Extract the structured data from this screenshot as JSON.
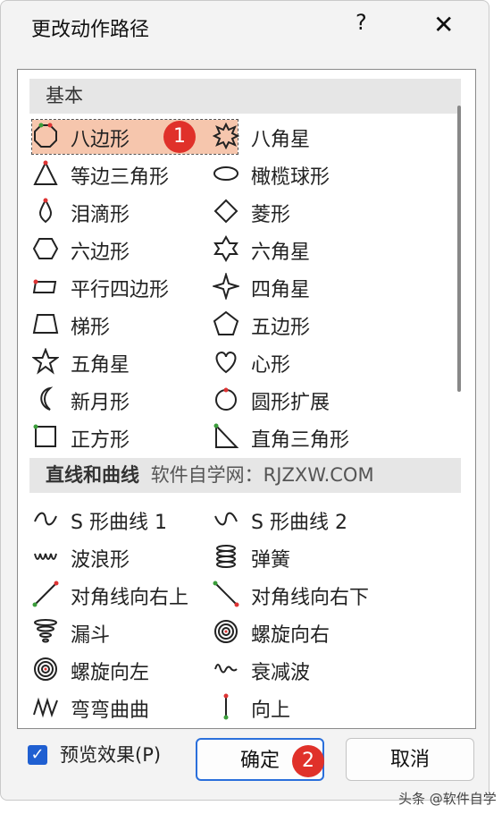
{
  "dialog": {
    "title": "更改动作路径",
    "help": "?",
    "close": "✕"
  },
  "groups": [
    {
      "title": "基本",
      "extra": ""
    },
    {
      "title": "直线和曲线",
      "extra": "软件自学网：RJZXW.COM"
    }
  ],
  "basic_items": [
    [
      "八边形",
      "八角星"
    ],
    [
      "等边三角形",
      "橄榄球形"
    ],
    [
      "泪滴形",
      "菱形"
    ],
    [
      "六边形",
      "六角星"
    ],
    [
      "平行四边形",
      "四角星"
    ],
    [
      "梯形",
      "五边形"
    ],
    [
      "五角星",
      "心形"
    ],
    [
      "新月形",
      "圆形扩展"
    ],
    [
      "正方形",
      "直角三角形"
    ]
  ],
  "line_items": [
    [
      "S 形曲线 1",
      "S 形曲线 2"
    ],
    [
      "波浪形",
      "弹簧"
    ],
    [
      "对角线向右上",
      "对角线向右下"
    ],
    [
      "漏斗",
      "螺旋向右"
    ],
    [
      "螺旋向左",
      "衰减波"
    ],
    [
      "弯弯曲曲",
      "向上"
    ]
  ],
  "badges": {
    "one": "1",
    "two": "2"
  },
  "footer": {
    "checkbox_label": "预览效果(P)",
    "ok": "确定",
    "cancel": "取消",
    "watermark": "头条 @软件自学"
  },
  "colors": {
    "selected": "#f6c6ad",
    "badge": "#e0312a",
    "accent": "#1f5fd1"
  }
}
